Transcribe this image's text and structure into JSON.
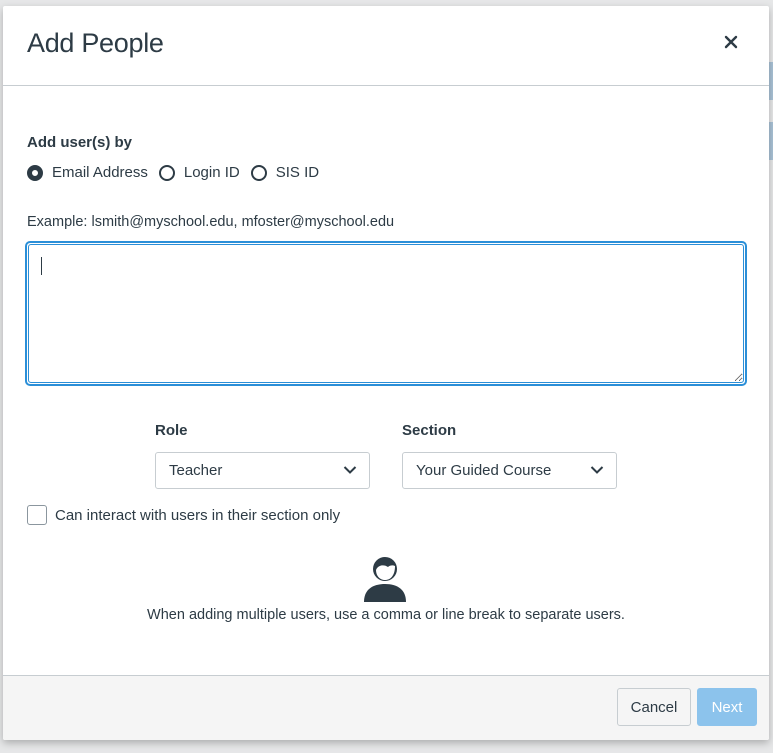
{
  "dialog": {
    "title": "Add People",
    "close_label": "close"
  },
  "add_by": {
    "label": "Add user(s) by",
    "options": [
      {
        "label": "Email Address",
        "checked": true
      },
      {
        "label": "Login ID",
        "checked": false
      },
      {
        "label": "SIS ID",
        "checked": false
      }
    ]
  },
  "example_text": "Example: lsmith@myschool.edu, mfoster@myschool.edu",
  "users_input": {
    "value": "",
    "placeholder": ""
  },
  "role": {
    "label": "Role",
    "selected": "Teacher"
  },
  "section": {
    "label": "Section",
    "selected": "Your Guided Course"
  },
  "limit_checkbox": {
    "label": "Can interact with users in their section only",
    "checked": false
  },
  "hint": "When adding multiple users, use a comma or line break to separate users.",
  "footer": {
    "cancel_label": "Cancel",
    "next_label": "Next"
  },
  "colors": {
    "text": "#2d3b45",
    "focus_border": "#2b8fd8",
    "next_button_disabled": "#8cc3ec",
    "footer_bg": "#f5f5f5"
  }
}
